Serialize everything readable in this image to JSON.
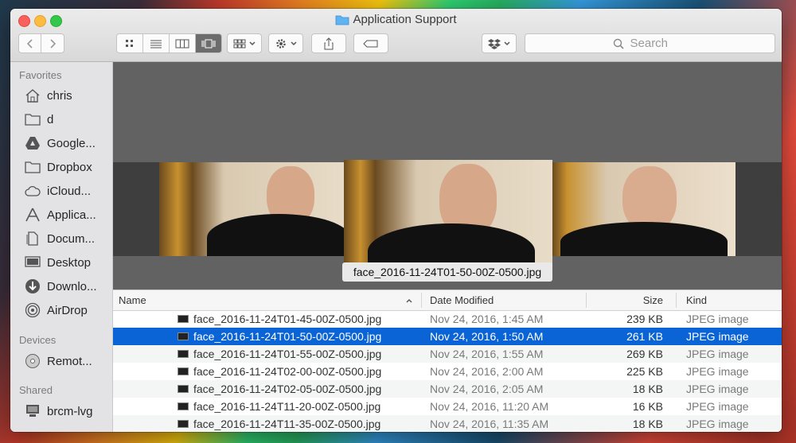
{
  "window": {
    "title": "Application Support"
  },
  "toolbar": {
    "search_placeholder": "Search",
    "icons": {
      "back": "chevron-left-icon",
      "forward": "chevron-right-icon",
      "view_icons": "grid-icon",
      "view_list": "list-icon",
      "view_columns": "columns-icon",
      "view_coverflow": "coverflow-icon",
      "arrange": "arrange-icon",
      "action": "gear-icon",
      "share": "share-icon",
      "tags": "tag-icon",
      "dropbox": "dropbox-icon",
      "search": "search-icon"
    }
  },
  "sidebar": {
    "favorites_label": "Favorites",
    "favorites": [
      {
        "label": "chris",
        "icon": "home-icon"
      },
      {
        "label": "d",
        "icon": "folder-icon"
      },
      {
        "label": "Google...",
        "icon": "google-drive-icon"
      },
      {
        "label": "Dropbox",
        "icon": "folder-icon"
      },
      {
        "label": "iCloud...",
        "icon": "cloud-icon"
      },
      {
        "label": "Applica...",
        "icon": "applications-icon"
      },
      {
        "label": "Docum...",
        "icon": "documents-icon"
      },
      {
        "label": "Desktop",
        "icon": "desktop-icon"
      },
      {
        "label": "Downlo...",
        "icon": "download-icon"
      },
      {
        "label": "AirDrop",
        "icon": "airdrop-icon"
      }
    ],
    "devices_label": "Devices",
    "devices": [
      {
        "label": "Remot...",
        "icon": "disc-icon"
      }
    ],
    "shared_label": "Shared",
    "shared": [
      {
        "label": "brcm-lvg",
        "icon": "computer-icon"
      }
    ]
  },
  "preview": {
    "caption": "face_2016-11-24T01-50-00Z-0500.jpg"
  },
  "list": {
    "columns": {
      "name": "Name",
      "date": "Date Modified",
      "size": "Size",
      "kind": "Kind"
    },
    "rows": [
      {
        "name": "face_2016-11-24T01-45-00Z-0500.jpg",
        "date": "Nov 24, 2016, 1:45 AM",
        "size": "239 KB",
        "kind": "JPEG image"
      },
      {
        "name": "face_2016-11-24T01-50-00Z-0500.jpg",
        "date": "Nov 24, 2016, 1:50 AM",
        "size": "261 KB",
        "kind": "JPEG image",
        "selected": true
      },
      {
        "name": "face_2016-11-24T01-55-00Z-0500.jpg",
        "date": "Nov 24, 2016, 1:55 AM",
        "size": "269 KB",
        "kind": "JPEG image"
      },
      {
        "name": "face_2016-11-24T02-00-00Z-0500.jpg",
        "date": "Nov 24, 2016, 2:00 AM",
        "size": "225 KB",
        "kind": "JPEG image"
      },
      {
        "name": "face_2016-11-24T02-05-00Z-0500.jpg",
        "date": "Nov 24, 2016, 2:05 AM",
        "size": "18 KB",
        "kind": "JPEG image"
      },
      {
        "name": "face_2016-11-24T11-20-00Z-0500.jpg",
        "date": "Nov 24, 2016, 11:20 AM",
        "size": "16 KB",
        "kind": "JPEG image"
      },
      {
        "name": "face_2016-11-24T11-35-00Z-0500.jpg",
        "date": "Nov 24, 2016, 11:35 AM",
        "size": "18 KB",
        "kind": "JPEG image"
      }
    ]
  },
  "colors": {
    "selection": "#0a64d6",
    "sidebar_bg": "#e3e3e6",
    "preview_bg": "#626262"
  }
}
